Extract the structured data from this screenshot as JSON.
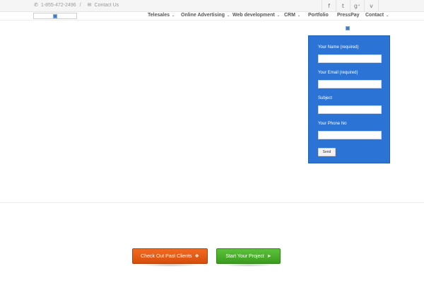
{
  "topbar": {
    "phone_icon": "phone-icon",
    "phone": "1-855-472-2496",
    "separator": "/",
    "mail_icon": "envelope-icon",
    "contact_link": "Contact Us",
    "social_icons": [
      "facebook-icon",
      "twitter-icon",
      "google-plus-icon",
      "vimeo-icon"
    ]
  },
  "nav": {
    "items": [
      {
        "label": "Telesales",
        "has_dropdown": true
      },
      {
        "label": "Online Advertising",
        "has_dropdown": true
      },
      {
        "label": "Web development",
        "has_dropdown": true
      },
      {
        "label": "CRM",
        "has_dropdown": true
      },
      {
        "label": "Portfolio",
        "has_dropdown": false
      },
      {
        "label": "PressPay",
        "has_dropdown": false
      },
      {
        "label": "Contact",
        "has_dropdown": true
      }
    ]
  },
  "form": {
    "name_label": "Your Name (required)",
    "name_value": "",
    "email_label": "Your Email (required)",
    "email_value": "",
    "subject_label": "Subject",
    "subject_value": "",
    "phone_label": "Your Phone No",
    "phone_value": "",
    "send_label": "Send"
  },
  "cta": {
    "past_clients_label": "Check Out Past Clients",
    "past_clients_icon": "diamond-icon",
    "start_project_label": "Start Your Project",
    "start_project_icon": "rocket-icon"
  },
  "colors": {
    "form_background": "#2b74d6",
    "cta_orange": "#e85c17",
    "cta_green": "#4cae2c"
  }
}
